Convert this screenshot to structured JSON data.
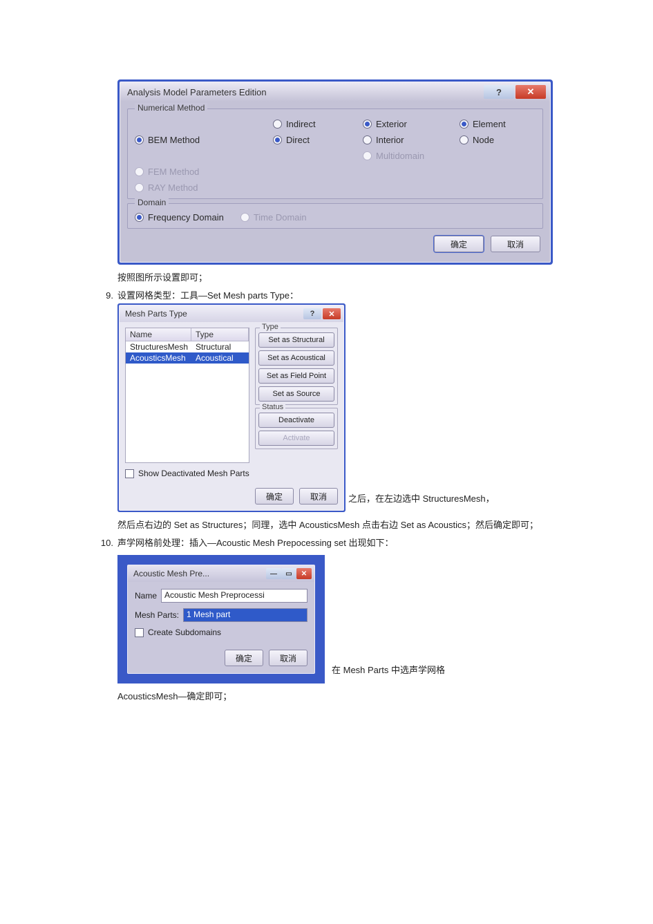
{
  "dialog1": {
    "title": "Analysis Model Parameters Edition",
    "group_numerical_legend": "Numerical Method",
    "radios": {
      "bem": {
        "label": "BEM Method",
        "checked": true,
        "disabled": false
      },
      "indirect": {
        "label": "Indirect",
        "checked": false,
        "disabled": false
      },
      "direct": {
        "label": "Direct",
        "checked": true,
        "disabled": false
      },
      "exterior": {
        "label": "Exterior",
        "checked": true,
        "disabled": false
      },
      "interior": {
        "label": "Interior",
        "checked": false,
        "disabled": false
      },
      "multidomain": {
        "label": "Multidomain",
        "checked": false,
        "disabled": true
      },
      "element": {
        "label": "Element",
        "checked": true,
        "disabled": false
      },
      "node": {
        "label": "Node",
        "checked": false,
        "disabled": false
      },
      "fem": {
        "label": "FEM Method",
        "checked": false,
        "disabled": true
      },
      "ray": {
        "label": "RAY Method",
        "checked": false,
        "disabled": true
      }
    },
    "group_domain_legend": "Domain",
    "domain_radios": {
      "frequency": {
        "label": "Frequency Domain",
        "checked": true,
        "disabled": false
      },
      "time": {
        "label": "Time Domain",
        "checked": false,
        "disabled": true
      }
    },
    "ok_label": "确定",
    "cancel_label": "取消"
  },
  "text": {
    "after_d1": "按照图所示设置即可；",
    "item9_num": "9.",
    "item9": "设置网格类型：工具—Set Mesh parts Type：",
    "after_d2_inline": "之后，在左边选中 StructuresMesh，",
    "after_d2_rest": "然后点右边的 Set as Structures；同理，选中 AcousticsMesh 点击右边 Set as Acoustics；然后确定即可；",
    "item10_num": "10.",
    "item10": "声学网格前处理：插入—Acoustic Mesh Prepocessing set  出现如下：",
    "after_d3_inline": "在 Mesh Parts  中选声学网格",
    "after_d3_rest": "AcousticsMesh—确定即可；"
  },
  "dialog2": {
    "title": "Mesh Parts Type",
    "col_name": "Name",
    "col_type": "Type",
    "rows": [
      {
        "name": "StructuresMesh",
        "type": "Structural",
        "selected": false
      },
      {
        "name": "AcousticsMesh",
        "type": "Acoustical",
        "selected": true
      }
    ],
    "show_deactivated_label": "Show Deactivated Mesh Parts",
    "type_group_legend": "Type",
    "btn_structural": "Set as Structural",
    "btn_acoustical": "Set as Acoustical",
    "btn_fieldpoint": "Set as Field Point",
    "btn_source": "Set as Source",
    "status_group_legend": "Status",
    "btn_deactivate": "Deactivate",
    "btn_activate": "Activate",
    "ok_label": "确定",
    "cancel_label": "取消"
  },
  "dialog3": {
    "title": "Acoustic Mesh Pre...",
    "name_label": "Name",
    "name_value": "Acoustic Mesh Preprocessi",
    "meshparts_label": "Mesh Parts:",
    "meshparts_value": "1 Mesh part",
    "create_subdomains_label": "Create Subdomains",
    "ok_label": "确定",
    "cancel_label": "取消"
  }
}
